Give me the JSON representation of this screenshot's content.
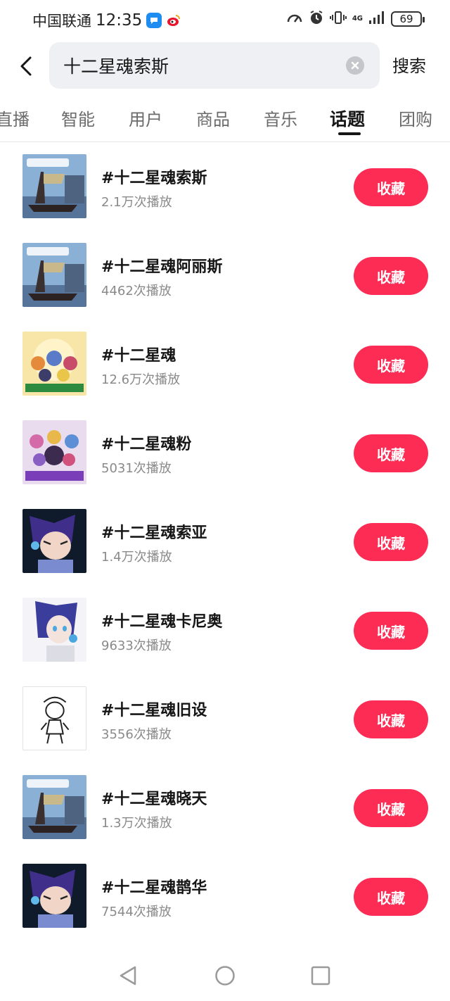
{
  "status_bar": {
    "carrier": "中国联通",
    "time": "12:35",
    "network": "4G",
    "battery": "69"
  },
  "search": {
    "query": "十二星魂索斯",
    "submit_label": "搜索"
  },
  "tabs": [
    {
      "label": "直播",
      "active": false
    },
    {
      "label": "智能",
      "active": false
    },
    {
      "label": "用户",
      "active": false
    },
    {
      "label": "商品",
      "active": false
    },
    {
      "label": "音乐",
      "active": false
    },
    {
      "label": "话题",
      "active": true
    },
    {
      "label": "团购",
      "active": false
    }
  ],
  "topics": [
    {
      "title": "#十二星魂索斯",
      "plays": "2.1万次播放",
      "button": "收藏",
      "thumb": "ship-poster"
    },
    {
      "title": "#十二星魂阿丽斯",
      "plays": "4462次播放",
      "button": "收藏",
      "thumb": "ship-poster"
    },
    {
      "title": "#十二星魂",
      "plays": "12.6万次播放",
      "button": "收藏",
      "thumb": "group-poster"
    },
    {
      "title": "#十二星魂粉",
      "plays": "5031次播放",
      "button": "收藏",
      "thumb": "group-poster-pink"
    },
    {
      "title": "#十二星魂索亚",
      "plays": "1.4万次播放",
      "button": "收藏",
      "thumb": "purple-character"
    },
    {
      "title": "#十二星魂卡尼奥",
      "plays": "9633次播放",
      "button": "收藏",
      "thumb": "blue-hair-character"
    },
    {
      "title": "#十二星魂旧设",
      "plays": "3556次播放",
      "button": "收藏",
      "thumb": "sketch-character"
    },
    {
      "title": "#十二星魂晓天",
      "plays": "1.3万次播放",
      "button": "收藏",
      "thumb": "ship-poster"
    },
    {
      "title": "#十二星魂鹊华",
      "plays": "7544次播放",
      "button": "收藏",
      "thumb": "purple-character"
    }
  ],
  "colors": {
    "accent": "#fd2c55",
    "secondary_text": "#8a8a8a",
    "search_bg": "#eef0f3"
  }
}
